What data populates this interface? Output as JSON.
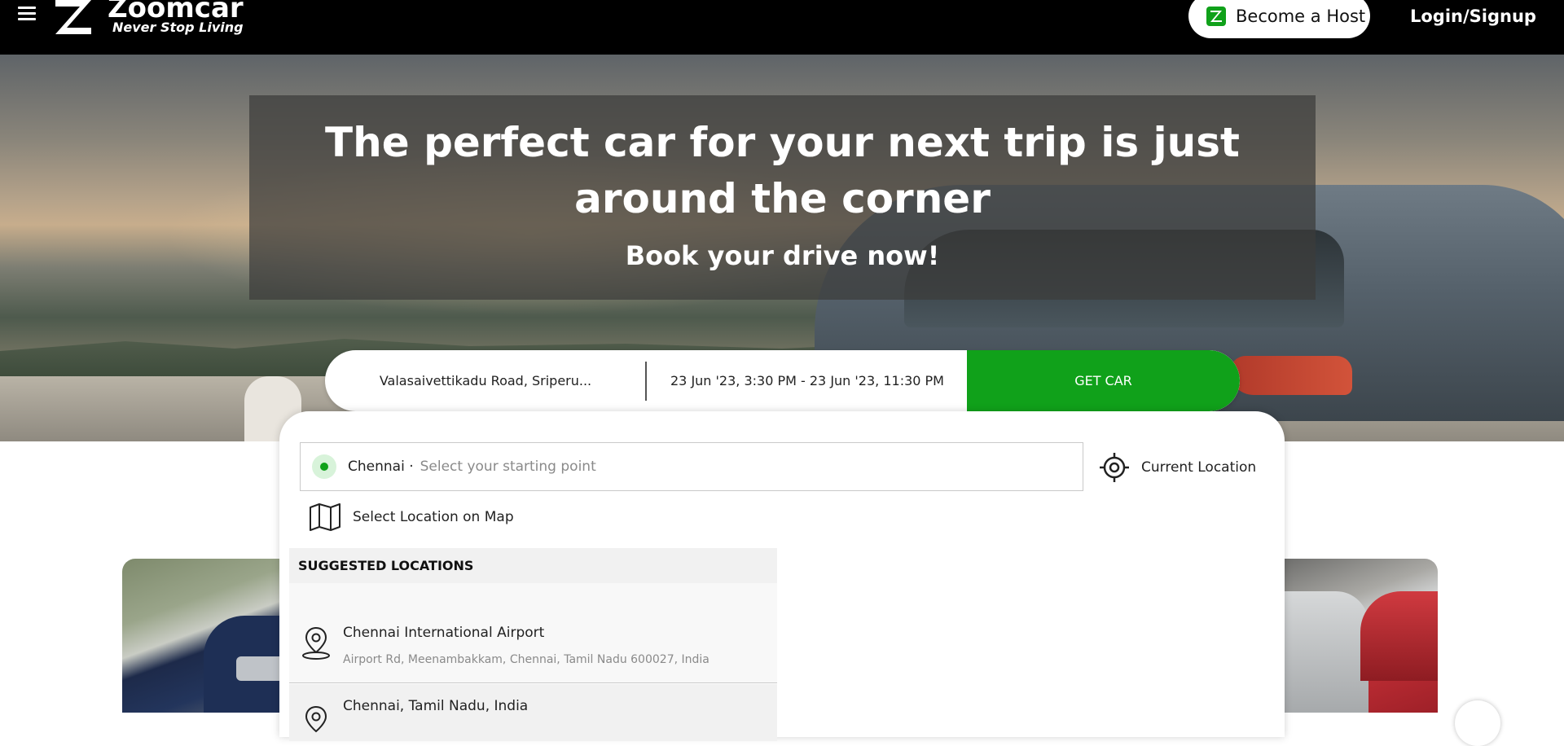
{
  "header": {
    "brand_name": "Zoomcar",
    "brand_tagline": "Never Stop Living",
    "host_button_label": "Become a Host",
    "login_label": "Login/Signup"
  },
  "hero": {
    "headline": "The perfect car for your next trip is just around the corner",
    "subheadline": "Book your drive now!"
  },
  "search_bar": {
    "location": "Valasaivettikadu Road, Sriperu...",
    "date_range": "23 Jun '23, 3:30 PM - 23 Jun '23, 11:30 PM",
    "get_car_label": "GET CAR"
  },
  "location_panel": {
    "city": "Chennai ·",
    "input_placeholder": "Select your starting point",
    "input_value": "",
    "current_location_label": "Current Location",
    "map_link_label": "Select Location on Map",
    "suggested_heading": "SUGGESTED LOCATIONS",
    "suggestions": [
      {
        "title": "Chennai International Airport",
        "address": "Airport Rd, Meenambakkam, Chennai, Tamil Nadu 600027, India"
      },
      {
        "title": "Chennai, Tamil Nadu, India",
        "address": ""
      }
    ]
  },
  "colors": {
    "accent_green": "#10a11a",
    "header_bg": "#000000"
  },
  "icons": {
    "menu": "hamburger-icon",
    "host": "zoomcar-z-icon",
    "current_location": "crosshair-icon",
    "map": "folded-map-icon",
    "suggestion": "map-pin-icon"
  }
}
